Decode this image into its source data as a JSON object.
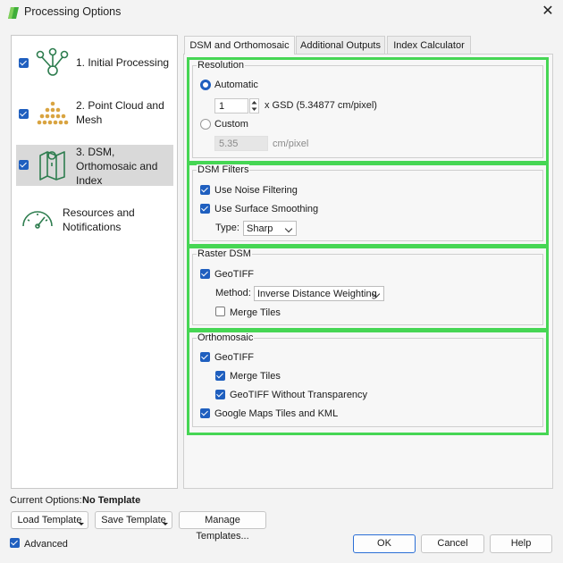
{
  "window": {
    "title": "Processing Options",
    "close_icon": "close-icon"
  },
  "nav": {
    "items": [
      {
        "label_lines": [
          "1. Initial Processing"
        ],
        "checked": true,
        "icon": "keypoints-icon"
      },
      {
        "label_lines": [
          "2. Point Cloud and",
          "Mesh"
        ],
        "checked": true,
        "icon": "point-cloud-icon"
      },
      {
        "label_lines": [
          "3. DSM,",
          "Orthomosaic and",
          "Index"
        ],
        "checked": true,
        "selected": true,
        "icon": "map-icon"
      },
      {
        "label_lines": [
          "Resources and",
          "Notifications"
        ],
        "checked": false,
        "icon": "gauge-icon"
      }
    ]
  },
  "tabs": [
    {
      "label": "DSM and Orthomosaic",
      "active": true
    },
    {
      "label": "Additional Outputs",
      "active": false
    },
    {
      "label": "Index Calculator",
      "active": false
    }
  ],
  "resolution": {
    "title": "Resolution",
    "automatic_label": "Automatic",
    "automatic_selected": true,
    "gsd_multiplier": "1",
    "gsd_text": "x GSD (5.34877 cm/pixel)",
    "custom_label": "Custom",
    "custom_selected": false,
    "custom_value": "5.35",
    "custom_unit": "cm/pixel"
  },
  "dsm_filters": {
    "title": "DSM Filters",
    "noise_label": "Use Noise Filtering",
    "noise_checked": true,
    "smoothing_label": "Use Surface Smoothing",
    "smoothing_checked": true,
    "type_label": "Type:",
    "type_value": "Sharp"
  },
  "raster_dsm": {
    "title": "Raster DSM",
    "geotiff_label": "GeoTIFF",
    "geotiff_checked": true,
    "method_label": "Method:",
    "method_value": "Inverse Distance Weighting",
    "merge_label": "Merge Tiles",
    "merge_checked": false
  },
  "orthomosaic": {
    "title": "Orthomosaic",
    "geotiff_label": "GeoTIFF",
    "geotiff_checked": true,
    "merge_label": "Merge Tiles",
    "merge_checked": true,
    "no_transparency_label": "GeoTIFF Without Transparency",
    "no_transparency_checked": true,
    "google_label": "Google Maps Tiles and KML",
    "google_checked": true
  },
  "footer": {
    "current_options_label": "Current Options:",
    "current_options_value": "No Template",
    "load_template": "Load Template",
    "save_template": "Save Template",
    "manage_templates": "Manage Templates...",
    "advanced_label": "Advanced",
    "advanced_checked": true,
    "ok": "OK",
    "cancel": "Cancel",
    "help": "Help"
  },
  "colors": {
    "highlight": "#46d654",
    "accent": "#1f5fbf",
    "icon_green": "#2e8b57"
  }
}
